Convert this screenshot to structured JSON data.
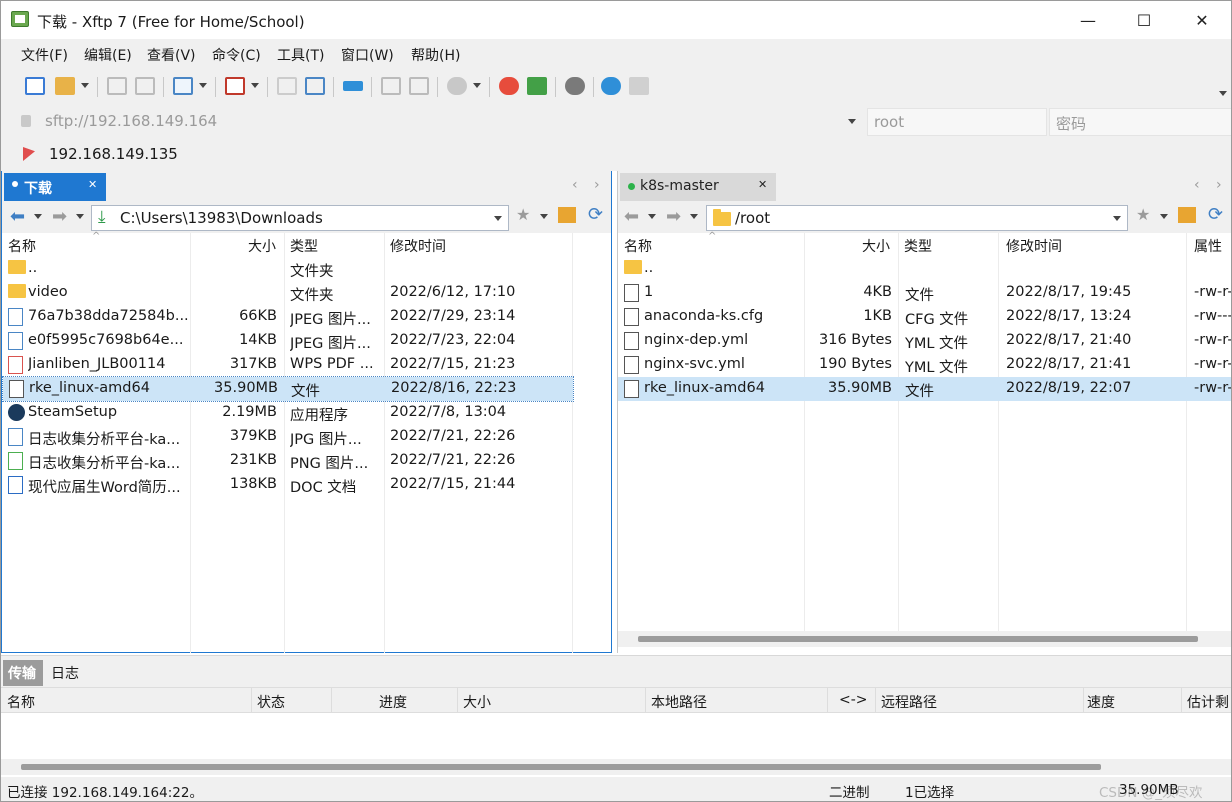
{
  "window": {
    "title": "下载 - Xftp 7 (Free for Home/School)",
    "min": "—",
    "max": "☐",
    "close": "✕"
  },
  "menu": [
    "文件(F)",
    "编辑(E)",
    "查看(V)",
    "命令(C)",
    "工具(T)",
    "窗口(W)",
    "帮助(H)"
  ],
  "address": {
    "host": "sftp://192.168.149.164",
    "user": "root",
    "password_placeholder": "密码"
  },
  "quick_link": "192.168.149.135",
  "left": {
    "tab": "下载",
    "path": "C:\\Users\\13983\\Downloads",
    "headers": [
      "名称",
      "大小",
      "类型",
      "修改时间"
    ],
    "rows": [
      {
        "name": "..",
        "size": "",
        "type": "文件夹",
        "modified": "",
        "icon": "folder"
      },
      {
        "name": "video",
        "size": "",
        "type": "文件夹",
        "modified": "2022/6/12, 17:10",
        "icon": "folder"
      },
      {
        "name": "76a7b38dda72584b...",
        "size": "66KB",
        "type": "JPEG 图片...",
        "modified": "2022/7/29, 23:14",
        "icon": "image"
      },
      {
        "name": "e0f5995c7698b64e...",
        "size": "14KB",
        "type": "JPEG 图片...",
        "modified": "2022/7/23, 22:04",
        "icon": "image"
      },
      {
        "name": "Jianliben_JLB00114",
        "size": "317KB",
        "type": "WPS PDF ...",
        "modified": "2022/7/15, 21:23",
        "icon": "pdf"
      },
      {
        "name": "rke_linux-amd64",
        "size": "35.90MB",
        "type": "文件",
        "modified": "2022/8/16, 22:23",
        "icon": "file"
      },
      {
        "name": "SteamSetup",
        "size": "2.19MB",
        "type": "应用程序",
        "modified": "2022/7/8, 13:04",
        "icon": "steam"
      },
      {
        "name": "日志收集分析平台-ka...",
        "size": "379KB",
        "type": "JPG 图片...",
        "modified": "2022/7/21, 22:26",
        "icon": "image"
      },
      {
        "name": "日志收集分析平台-ka...",
        "size": "231KB",
        "type": "PNG 图片...",
        "modified": "2022/7/21, 22:26",
        "icon": "png"
      },
      {
        "name": "现代应届生Word简历...",
        "size": "138KB",
        "type": "DOC 文档",
        "modified": "2022/7/15, 21:44",
        "icon": "doc"
      }
    ],
    "selected_index": 5
  },
  "right": {
    "tab": "k8s-master",
    "path": "/root",
    "headers": [
      "名称",
      "大小",
      "类型",
      "修改时间",
      "属性"
    ],
    "rows": [
      {
        "name": "..",
        "size": "",
        "type": "",
        "modified": "",
        "attr": "",
        "icon": "folder"
      },
      {
        "name": "1",
        "size": "4KB",
        "type": "文件",
        "modified": "2022/8/17, 19:45",
        "attr": "-rw-r-",
        "icon": "file"
      },
      {
        "name": "anaconda-ks.cfg",
        "size": "1KB",
        "type": "CFG 文件",
        "modified": "2022/8/17, 13:24",
        "attr": "-rw---",
        "icon": "file"
      },
      {
        "name": "nginx-dep.yml",
        "size": "316 Bytes",
        "type": "YML 文件",
        "modified": "2022/8/17, 21:40",
        "attr": "-rw-r-",
        "icon": "file"
      },
      {
        "name": "nginx-svc.yml",
        "size": "190 Bytes",
        "type": "YML 文件",
        "modified": "2022/8/17, 21:41",
        "attr": "-rw-r-",
        "icon": "file"
      },
      {
        "name": "rke_linux-amd64",
        "size": "35.90MB",
        "type": "文件",
        "modified": "2022/8/19, 22:07",
        "attr": "-rw-r-",
        "icon": "file"
      }
    ],
    "selected_index": 5
  },
  "transfer": {
    "tabs": [
      "传输",
      "日志"
    ],
    "headers": [
      "名称",
      "状态",
      "进度",
      "大小",
      "本地路径",
      "<->",
      "远程路径",
      "速度",
      "估计剩"
    ]
  },
  "status": {
    "connection": "已连接 192.168.149.164:22。",
    "mode": "二进制",
    "selection": "1已选择",
    "size": "35.90MB",
    "watermark": "CSDN @_须尽欢"
  },
  "colors": {
    "accent": "#1f78d1",
    "selection_bg": "#cce4f7",
    "folder": "#f6c443"
  }
}
